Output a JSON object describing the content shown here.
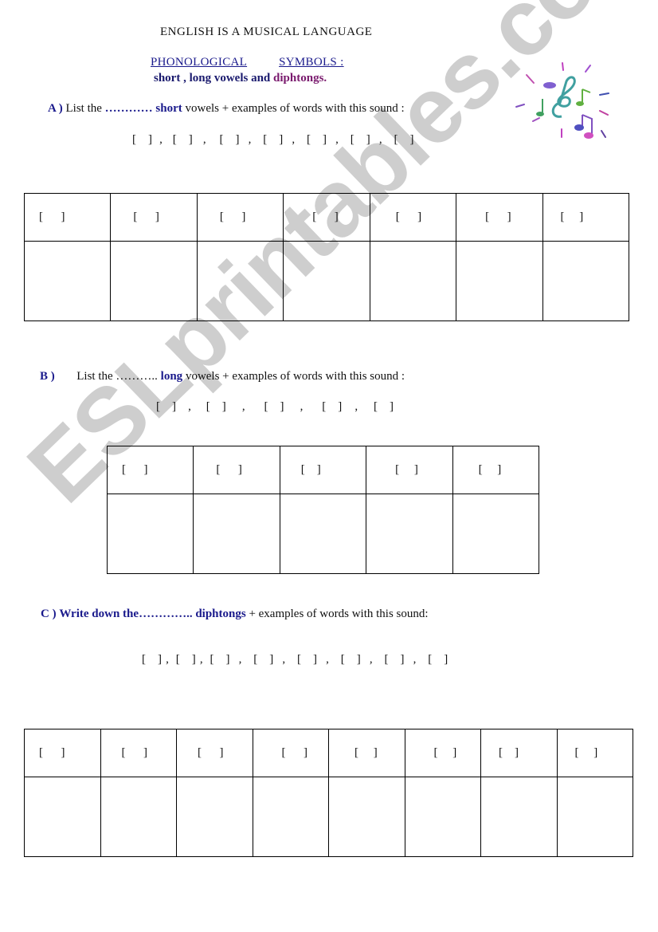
{
  "header": {
    "title": "ENGLISH  IS  A  MUSICAL  LANGUAGE",
    "subtitle_part1": "PHONOLOGICAL",
    "subtitle_part2": "SYMBOLS :",
    "subline_part1": "short , long vowels and",
    "subline_part2": "diphtongs.",
    "decoration_icon": "music-notes-icon"
  },
  "section_a": {
    "label": "A )",
    "text_before": "List  the",
    "dots": "…………",
    "keyword": "short",
    "text_after": "vowels  + examples of words with this sound :",
    "bracket_list": [
      "[    ]",
      "[    ]",
      "[    ]",
      "[    ]",
      "[    ]",
      "[    ]",
      "[    ]"
    ],
    "table_headers": [
      "[      ]",
      "[      ]",
      "[      ]",
      "[      ]",
      "[      ]",
      "[      ]",
      "[     ]"
    ]
  },
  "section_b": {
    "label": "B )",
    "text_before": "List  the",
    "dots": "………..",
    "keyword": "long",
    "text_after": "vowels + examples of words with this sound :",
    "bracket_list": [
      "[    ]",
      "[    ]",
      "[    ]",
      "[    ]",
      "[    ]"
    ],
    "table_headers": [
      "[      ]",
      "[      ]",
      "[    ]",
      "[     ]",
      "[     ]"
    ]
  },
  "section_c": {
    "label": "C )",
    "text_before": "Write down the",
    "dots": "…………..",
    "keyword": "diphtongs",
    "text_after": "+ examples of words with this sound:",
    "bracket_list": [
      "[    ]",
      "[    ]",
      "[    ]",
      "[    ]",
      "[    ]",
      "[    ]",
      "[    ]",
      "[    ]"
    ],
    "table_headers": [
      "[      ]",
      "[      ]",
      "[      ]",
      "[      ]",
      "[     ]",
      "[     ]",
      "[    ]",
      "[     ]"
    ]
  },
  "watermark": "ESLprintables.com",
  "colors": {
    "navy": "#1a1a8c",
    "purple": "#7a1a6e",
    "watermark": "#c9c9c9"
  }
}
